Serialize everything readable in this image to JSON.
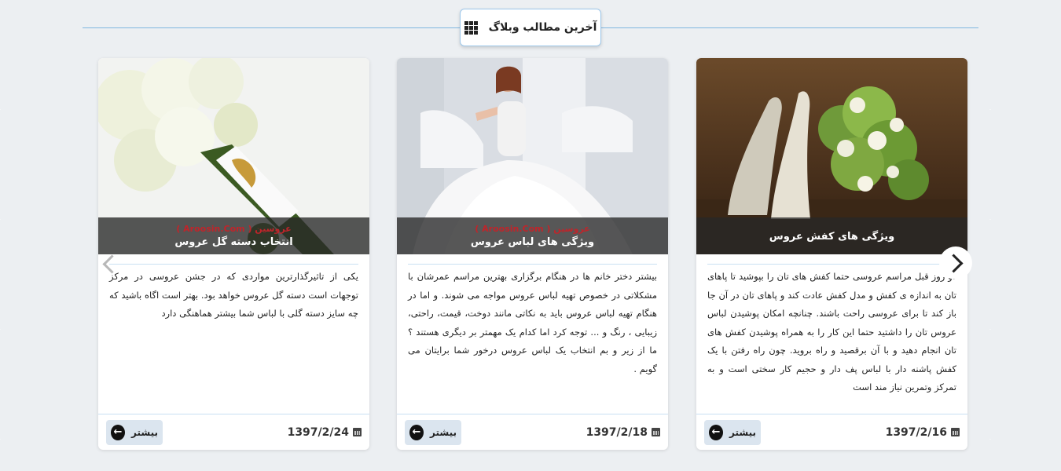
{
  "header": {
    "title": "آخرین مطالب وبلاگ"
  },
  "posts": [
    {
      "caption": "ویژگی های کفش عروس",
      "watermark": "",
      "excerpt": "دو روز قبل مراسم عروسی حتما کفش های تان را بپوشید تا پاهای تان به اندازه ی کفش و مدل کفش عادت کند و پاهای تان در آن جا باز کند تا برای عروسی راحت باشند. چنانچه امکان پوشیدن لباس عروس تان را داشتید حتما این کار را به همراه پوشیدن کفش های تان انجام دهید و با آن برقصید و راه بروید. چون راه رفتن با یک کفش پاشنه دار با لباس پف دار و حجیم کار سختی است و به تمرکز وتمرین نیاز مند است",
      "date": "1397/2/16",
      "more_label": "بیشتر"
    },
    {
      "caption": "ویژگی های لباس عروس",
      "watermark": "( Aroosin.Com ) عروسین",
      "excerpt": "بیشتر دختر خانم ها در هنگام برگزاری بهترین مراسم عمرشان با مشکلاتی در خصوص تهیه لباس عروس مواجه می شوند. و اما در هنگام تهیه لباس عروس باید به نکاتی مانند دوخت، قیمت، راحتی، زیبایی ، رنگ و ... توجه کرد اما کدام یک مهمتر بر دیگری هستند ؟ ما از زیر و بم انتخاب یک لباس عروس درخور شما برایتان می گویم .",
      "date": "1397/2/18",
      "more_label": "بیشتر"
    },
    {
      "caption": "انتخاب دسته گل عروس",
      "watermark": "( Aroosin.Com ) عروسین",
      "excerpt": "یکی از تاثیرگذارترین مواردی که در جشن عروسی در مرکز توجهات است دسته گل عروس خواهد بود. بهتر است اگاه باشید که چه سایز دسته گلی با لباس شما بیشتر هماهنگی دارد",
      "date": "1397/2/24",
      "more_label": "بیشتر"
    }
  ]
}
